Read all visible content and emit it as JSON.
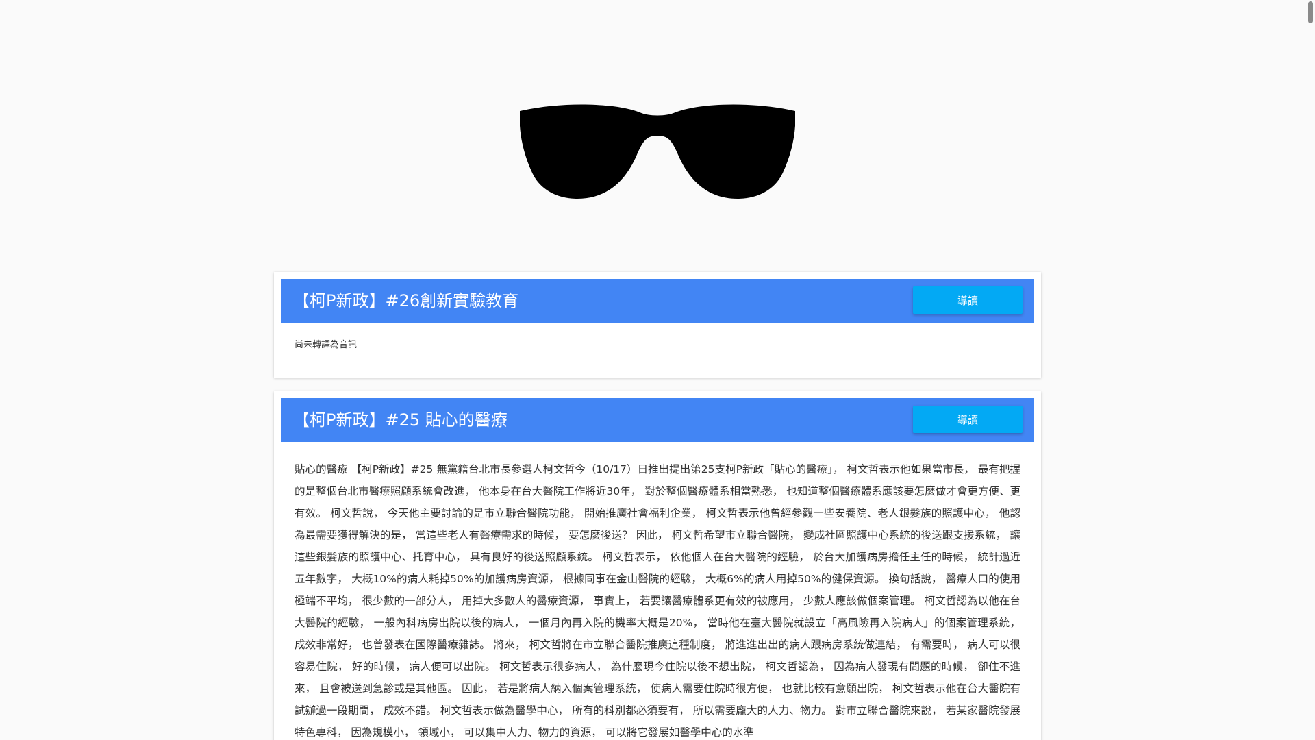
{
  "header": {
    "logo_icon": "sunglasses-icon",
    "logo_color": "#000000"
  },
  "articles": [
    {
      "title": "【柯P新政】#26創新實驗教育",
      "button_label": "導讀",
      "body": "尚未轉譯為音訊"
    },
    {
      "title": "【柯P新政】#25 貼心的醫療",
      "button_label": "導讀",
      "body": "貼心的醫療 【柯P新政】#25 無黨籍台北市長參選人柯文哲今（10/17）日推出提出第25支柯P新政「貼心的醫療」， 柯文哲表示他如果當市長， 最有把握的是整個台北市醫療照顧系統會改進， 他本身在台大醫院工作將近30年， 對於整個醫療體系相當熟悉， 也知道整個醫療體系應該要怎麼做才會更方便、更有效。 柯文哲說， 今天他主要討論的是市立聯合醫院功能， 開始推廣社會福利企業， 柯文哲表示他曾經參觀一些安養院、老人銀髮族的照護中心， 他認為最需要獲得解決的是， 當這些老人有醫療需求的時候， 要怎麼後送？ 因此， 柯文哲希望市立聯合醫院， 變成社區照護中心系統的後送跟支援系統， 讓這些銀髮族的照護中心、托育中心， 具有良好的後送照顧系統。 柯文哲表示， 依他個人在台大醫院的經驗， 於台大加護病房擔任主任的時候， 統計過近五年數字， 大概10%的病人耗掉50%的加護病房資源， 根據同事在金山醫院的經驗， 大概6%的病人用掉50%的健保資源。 換句話說， 醫療人口的使用極端不平均， 很少數的一部分人， 用掉大多數人的醫療資源， 事實上， 若要讓醫療體系更有效的被應用， 少數人應該做個案管理。 柯文哲認為以他在台大醫院的經驗， 一般內科病房出院以後的病人， 一個月內再入院的機率大概是20%， 當時他在臺大醫院就設立「高風險再入院病人」的個案管理系統， 成效非常好， 也曾發表在國際醫療雜誌。 將來， 柯文哲將在市立聯合醫院推廣這種制度， 將進進出出的病人跟病房系統做連結， 有需要時， 病人可以很容易住院， 好的時候， 病人便可以出院。 柯文哲表示很多病人， 為什麼現今住院以後不想出院， 柯文哲認為， 因為病人發現有問題的時候， 卻住不進來， 且會被送到急診或是其他區。 因此， 若是將病人納入個案管理系統， 使病人需要住院時很方便， 也就比較有意願出院， 柯文哲表示他在台大醫院有試辦過一段期間， 成效不錯。 柯文哲表示做為醫學中心， 所有的科別都必須要有， 所以需要龐大的人力、物力。 對市立聯合醫院來說， 若某家醫院發展特色專科， 因為規模小， 領域小， 可以集中人力、物力的資源， 可以將它發展如醫學中心的水準"
    }
  ],
  "colors": {
    "header_bar": "#4285f4",
    "button": "#03a9f4",
    "background": "#fafafa"
  }
}
